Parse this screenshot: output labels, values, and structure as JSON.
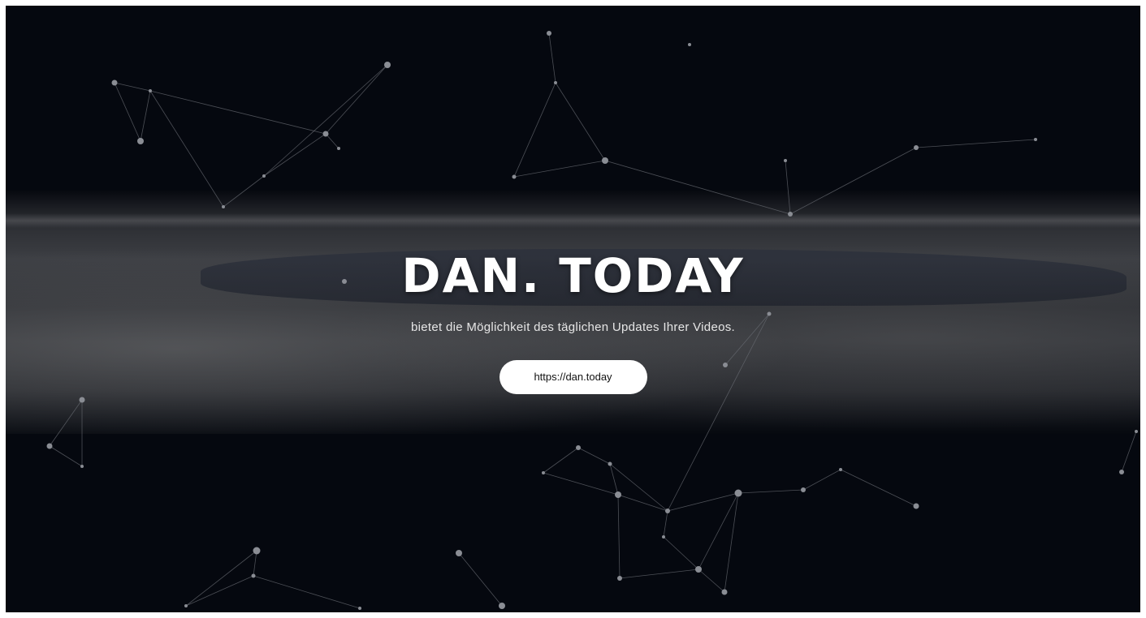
{
  "hero": {
    "title": "DAN. TODAY",
    "subtitle": "bietet die Möglichkeit des täglichen Updates Ihrer Videos.",
    "button_label": "https://dan.today"
  },
  "colors": {
    "background": "#05080f",
    "network_line": "#6b6e75",
    "network_node": "#8a8d94",
    "button_bg": "#ffffff",
    "button_text": "#111111",
    "title": "#ffffff"
  }
}
